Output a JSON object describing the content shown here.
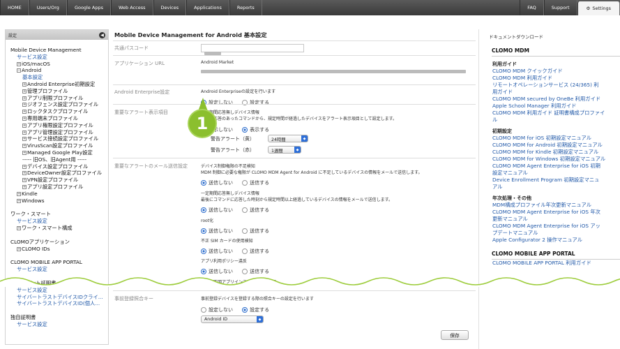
{
  "nav": {
    "items": [
      "HOME",
      "Users/Org",
      "Google Apps",
      "Web Access",
      "Devices",
      "Applications",
      "Reports"
    ],
    "faq": "FAQ",
    "support": "Support",
    "settings": "Settings"
  },
  "left": {
    "header": "設定",
    "tree1": [
      "Mobile Device Management",
      "サービス設定",
      "iOS/macOS",
      "Android",
      "基本設定",
      "Android Enterprise初期設定",
      "管理プロファイル",
      "アプリ制限プロファイル",
      "ジオフェンス設定プロファイル",
      "ロックタスクプロファイル",
      "専用端末プロファイル",
      "アプリ権限設定プロファイル",
      "アプリ管理設定プロファイル",
      "サービス接続設定プロファイル",
      "VirusScan設定プロファイル",
      "Managed Google Play設定",
      "----- 旧OS、旧Agent用 -----",
      "デバイス設定プロファイル",
      "DeviceOwner設定プロファイル",
      "VPN設定プロファイル",
      "アプリ設定プロファイル",
      "Kindle",
      "Windows"
    ],
    "tree2": [
      "ワーク・スマート",
      "サービス設定",
      "ワーク・スマート構成"
    ],
    "tree3": [
      "CLOMOアプリケーション",
      "CLOMO IDs"
    ],
    "tree4": [
      "CLOMO MOBILE APP PORTAL",
      "サービス設定"
    ],
    "tree5": [
      "クライアント証明書",
      "サービス設定",
      "サイバートラストデバイスIDクライ...",
      "サイバートラストデバイスID(個人..."
    ],
    "tree6": [
      "独自証明書",
      "サービス設定"
    ]
  },
  "main": {
    "title": "Mobile Device Management for Android 基本設定",
    "passcode_label": "共通パスコード",
    "app_url_label": "アプリケーション URL",
    "app_url_value": "Android Market",
    "ae_label": "Android Enterprise設定",
    "ae_desc": "Android Enterpriseの設定を行います",
    "opt_off": "設定しない",
    "opt_on": "設定する",
    "alert_label": "重要なアラート表示項目",
    "alert_t1": "一定期間応答無しデバイス情報",
    "alert_t2": "最後に応答のあったコマンドから、規定時間が経過したデバイスをアラート表示項目として設定します。",
    "show_off": "表示しない",
    "show_on": "表示する",
    "alert_yellow": "警告アラート（黄）",
    "alert_yellow_val": "24時間",
    "alert_red": "警告アラート（赤）",
    "alert_red_val": "1週間",
    "mail_label": "重要なアラートのメール送信設定",
    "m1_t": "デバイス制御権限の不足検知",
    "m1_d": "MDM 制御に必要な権限が CLOMO MDM Agent for Android に不足しているデバイスの情報をメールで送信します。",
    "m2_t": "一定期間応答無しデバイス情報",
    "m2_d": "最後にコマンドに応答した時刻から規定時間以上経過しているデバイスの情報をメールで送信します。",
    "m3_t": "root化",
    "m4_t": "不正 SIM カードの使用検知",
    "m5_t": "アプリ利用ポリシー違反",
    "m6_t": "提供元不明アプリインストール許可検知",
    "send_off": "送信しない",
    "send_on": "送信する",
    "prereg_label": "事前登録照合キー",
    "prereg_desc": "事前登録デバイスを登録する際の照合キーの設定を行います",
    "prereg_select": "Android ID",
    "save": "保存",
    "badge": "1"
  },
  "right": {
    "header": "ドキュメントダウンロード",
    "sec1": "CLOMO MDM",
    "sub1": "利用ガイド",
    "l1": [
      "CLOMO MDM クイックガイド",
      "CLOMO MDM 利用ガイド",
      "リモートオペレーションサービス (24/365) 利",
      "用ガイド",
      "CLOMO MDM secured by OneBe 利用ガイド",
      "Apple School Manager 利用ガイド",
      "CLOMO MDM 利用ガイド 証明書構成プロファイ",
      "ル"
    ],
    "sub2": "初期設定",
    "l2": [
      "CLOMO MDM for iOS 初期設定マニュアル",
      "CLOMO MDM for Android 初期設定マニュアル",
      "",
      "CLOMO MDM for Kindle 初期設定マニュアル",
      "CLOMO MDM for Windows 初期設定マニュアル",
      "",
      "CLOMO MDM Agent Enterprise for iOS 初期",
      "設定マニュアル",
      "Device Enrollment Program 初期設定マニュ",
      "アル"
    ],
    "sub3": "年次処理・その他",
    "l3": [
      "MDM構成プロファイル年次更新マニュアル",
      "CLOMO MDM Agent Enterprise for iOS 年次",
      "更新マニュアル",
      "CLOMO MDM Agent Enterprise for iOS アッ",
      "プデートマニュアル",
      "Apple Configurator 2 操作マニュアル"
    ],
    "sec2": "CLOMO MOBILE APP PORTAL",
    "l4": [
      "CLOMO MOBILE APP PORTAL 利用ガイド"
    ]
  }
}
